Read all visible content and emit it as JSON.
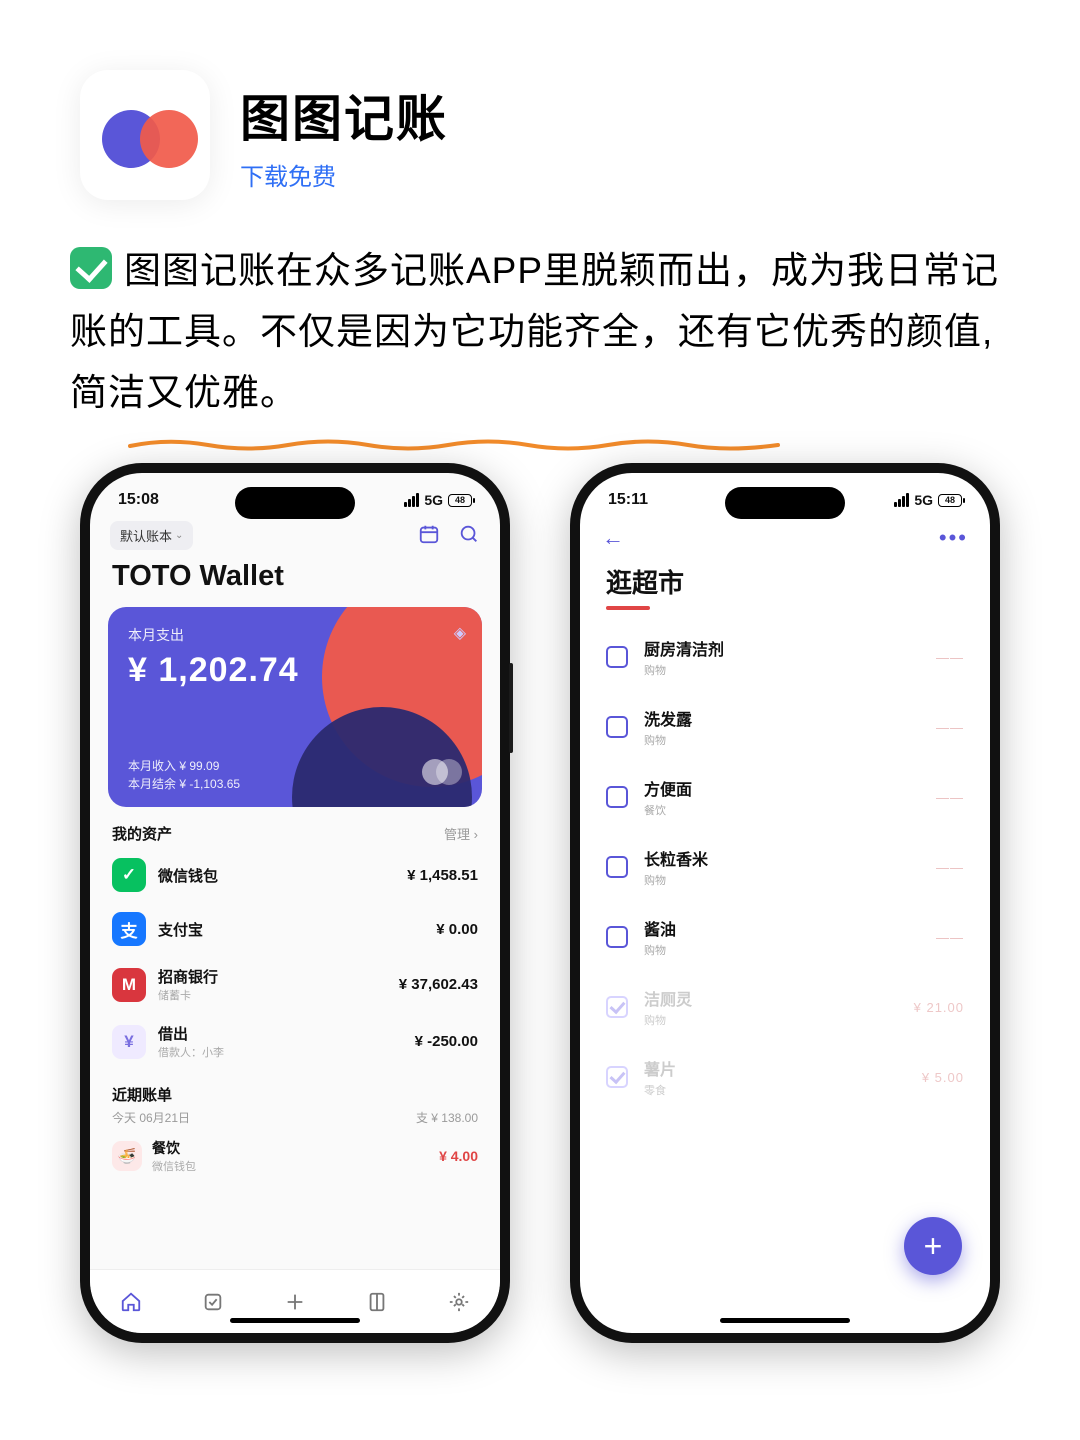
{
  "header": {
    "app_name": "图图记账",
    "subtitle": "下载免费"
  },
  "blurb": {
    "text": "图图记账在众多记账APP里脱颖而出，成为我日常记账的工具。不仅是因为它功能齐全，还有它优秀的颜值,简洁又优雅。"
  },
  "phone1": {
    "status_time": "15:08",
    "status_net": "5G",
    "status_batt": "48",
    "ledger_label": "默认账本",
    "wallet_title": "TOTO Wallet",
    "card": {
      "spend_label": "本月支出",
      "spend_amount": "¥ 1,202.74",
      "income_line": "本月收入 ¥ 99.09",
      "balance_line": "本月结余 ¥ -1,103.65"
    },
    "assets_title": "我的资产",
    "assets_manage": "管理 ›",
    "assets": [
      {
        "name": "微信钱包",
        "sub": "",
        "value": "¥ 1,458.51",
        "bg": "#07c160",
        "glyph": "✓"
      },
      {
        "name": "支付宝",
        "sub": "",
        "value": "¥ 0.00",
        "bg": "#1677ff",
        "glyph": "支"
      },
      {
        "name": "招商银行",
        "sub": "储蓄卡",
        "value": "¥ 37,602.43",
        "bg": "#d9363e",
        "glyph": "M"
      },
      {
        "name": "借出",
        "sub": "借款人：小李",
        "value": "¥ -250.00",
        "bg": "#efeaff",
        "glyph": "¥"
      }
    ],
    "bills_title": "近期账单",
    "bills_date": "今天 06月21日",
    "bills_spend": "支 ¥ 138.00",
    "bills": [
      {
        "name": "餐饮",
        "sub": "微信钱包",
        "value": "¥ 4.00"
      }
    ]
  },
  "phone2": {
    "status_time": "15:11",
    "status_net": "5G",
    "status_batt": "48",
    "title": "逛超市",
    "items": [
      {
        "name": "厨房清洁剂",
        "sub": "购物",
        "price": "——",
        "done": false
      },
      {
        "name": "洗发露",
        "sub": "购物",
        "price": "——",
        "done": false
      },
      {
        "name": "方便面",
        "sub": "餐饮",
        "price": "——",
        "done": false
      },
      {
        "name": "长粒香米",
        "sub": "购物",
        "price": "——",
        "done": false
      },
      {
        "name": "酱油",
        "sub": "购物",
        "price": "——",
        "done": false
      },
      {
        "name": "洁厕灵",
        "sub": "购物",
        "price": "¥ 21.00",
        "done": true
      },
      {
        "name": "薯片",
        "sub": "零食",
        "price": "¥ 5.00",
        "done": true
      }
    ]
  }
}
